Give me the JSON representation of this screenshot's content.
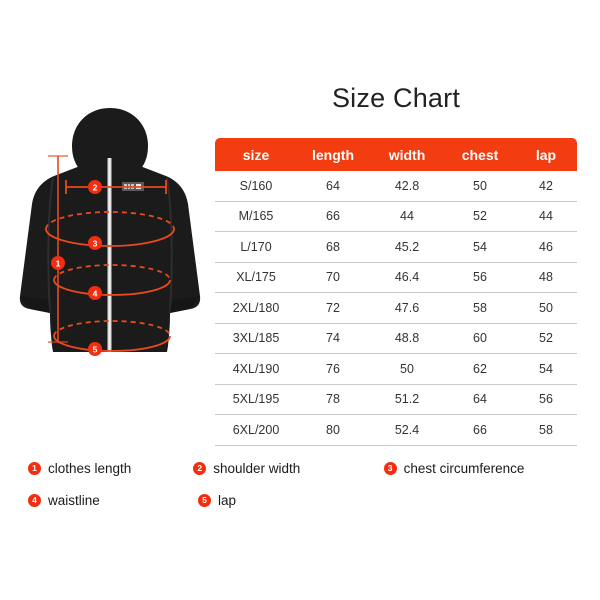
{
  "page": {
    "title": "Size Chart",
    "background_color": "#ffffff"
  },
  "colors": {
    "accent": "#f33c10",
    "badge": "#f22d10",
    "header_text": "#ffffff",
    "cell_text": "#333333",
    "row_divider": "#c9c9c9",
    "garment_fill": "#1b1b1b",
    "measure_line": "#e8491d"
  },
  "table": {
    "columns": [
      "size",
      "length",
      "width",
      "chest",
      "lap"
    ],
    "rows": [
      {
        "size": "S/160",
        "length": "64",
        "width": "42.8",
        "chest": "50",
        "lap": "42"
      },
      {
        "size": "M/165",
        "length": "66",
        "width": "44",
        "chest": "52",
        "lap": "44"
      },
      {
        "size": "L/170",
        "length": "68",
        "width": "45.2",
        "chest": "54",
        "lap": "46"
      },
      {
        "size": "XL/175",
        "length": "70",
        "width": "46.4",
        "chest": "56",
        "lap": "48"
      },
      {
        "size": "2XL/180",
        "length": "72",
        "width": "47.6",
        "chest": "58",
        "lap": "50"
      },
      {
        "size": "3XL/185",
        "length": "74",
        "width": "48.8",
        "chest": "60",
        "lap": "52"
      },
      {
        "size": "4XL/190",
        "length": "76",
        "width": "50",
        "chest": "62",
        "lap": "54"
      },
      {
        "size": "5XL/195",
        "length": "78",
        "width": "51.2",
        "chest": "64",
        "lap": "56"
      },
      {
        "size": "6XL/200",
        "length": "80",
        "width": "52.4",
        "chest": "66",
        "lap": "58"
      }
    ]
  },
  "legend": {
    "items": [
      {
        "number": "1",
        "label": "clothes length"
      },
      {
        "number": "2",
        "label": "shoulder width"
      },
      {
        "number": "3",
        "label": "chest circumference"
      },
      {
        "number": "4",
        "label": "waistline"
      },
      {
        "number": "5",
        "label": "lap"
      }
    ]
  },
  "illustration": {
    "garment": "hooded-jacket-back-view",
    "markers": [
      {
        "number": "1",
        "measure": "clothes length"
      },
      {
        "number": "2",
        "measure": "shoulder width"
      },
      {
        "number": "3",
        "measure": "chest circumference"
      },
      {
        "number": "4",
        "measure": "waistline"
      },
      {
        "number": "5",
        "measure": "lap"
      }
    ]
  }
}
